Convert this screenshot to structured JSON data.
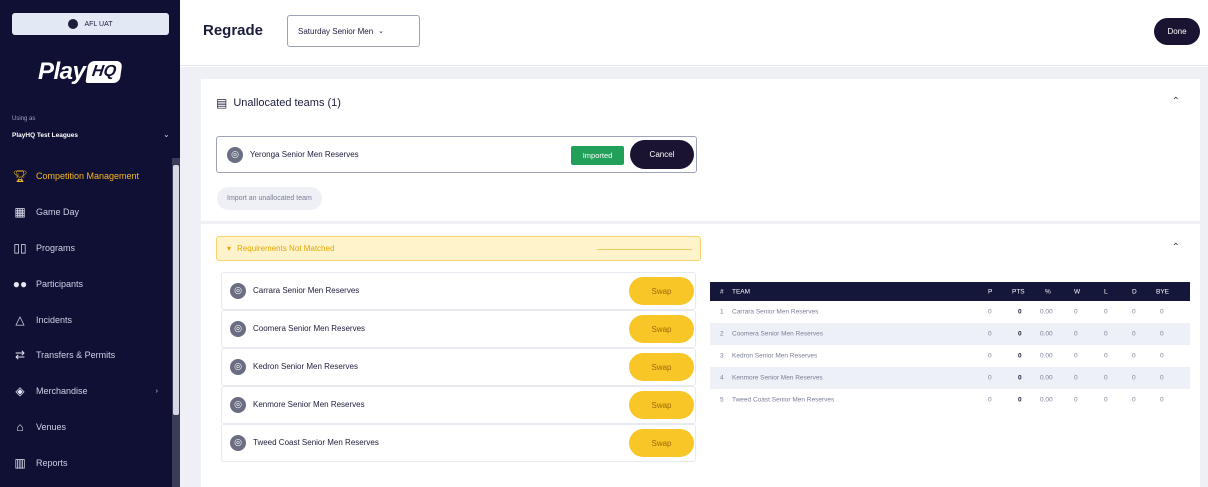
{
  "env": {
    "label": "AFL UAT"
  },
  "brand": {
    "play": "Play",
    "hq": "HQ"
  },
  "account": {
    "using_as_label": "Using as",
    "org_name": "PlayHQ Test Leagues"
  },
  "sidebar": {
    "items": [
      {
        "label": "Competition Management",
        "icon": "trophy-icon",
        "active": true
      },
      {
        "label": "Game Day",
        "icon": "scoreboard-icon"
      },
      {
        "label": "Programs",
        "icon": "book-icon"
      },
      {
        "label": "Participants",
        "icon": "people-icon"
      },
      {
        "label": "Incidents",
        "icon": "warning-icon"
      },
      {
        "label": "Transfers & Permits",
        "icon": "transfer-icon"
      },
      {
        "label": "Merchandise",
        "icon": "shirt-icon"
      },
      {
        "label": "Venues",
        "icon": "stadium-icon"
      },
      {
        "label": "Reports",
        "icon": "chart-icon"
      }
    ]
  },
  "header": {
    "title": "Regrade",
    "grade_value": "Saturday Senior Men",
    "done_label": "Done"
  },
  "unallocated": {
    "title": "Unallocated teams (1)",
    "team_name": "Yeronga Senior Men Reserves",
    "status": "Imported",
    "cancel_label": "Cancel",
    "import_label": "Import an unallocated team"
  },
  "regrade": {
    "banner": "Requirements Not Matched",
    "swap_label": "Swap",
    "teams": [
      "Carrara Senior Men Reserves",
      "Coomera Senior Men Reserves",
      "Kedron Senior Men Reserves",
      "Kenmore Senior Men Reserves",
      "Tweed Coast Senior Men Reserves"
    ]
  },
  "ladder": {
    "headers": {
      "pos": "#",
      "team": "TEAM",
      "p": "P",
      "pts": "PTS",
      "pct": "%",
      "w": "W",
      "l": "L",
      "d": "D",
      "bye": "BYE"
    },
    "rows": [
      {
        "pos": "1",
        "team": "Carrara Senior Men Reserves",
        "p": "0",
        "pts": "0",
        "pct": "0.00",
        "w": "0",
        "l": "0",
        "d": "0",
        "bye": "0"
      },
      {
        "pos": "2",
        "team": "Coomera Senior Men Reserves",
        "p": "0",
        "pts": "0",
        "pct": "0.00",
        "w": "0",
        "l": "0",
        "d": "0",
        "bye": "0"
      },
      {
        "pos": "3",
        "team": "Kedron Senior Men Reserves",
        "p": "0",
        "pts": "0",
        "pct": "0.00",
        "w": "0",
        "l": "0",
        "d": "0",
        "bye": "0"
      },
      {
        "pos": "4",
        "team": "Kenmore Senior Men Reserves",
        "p": "0",
        "pts": "0",
        "pct": "0.00",
        "w": "0",
        "l": "0",
        "d": "0",
        "bye": "0"
      },
      {
        "pos": "5",
        "team": "Tweed Coast Senior Men Reserves",
        "p": "0",
        "pts": "0",
        "pct": "0.00",
        "w": "0",
        "l": "0",
        "d": "0",
        "bye": "0"
      }
    ]
  }
}
